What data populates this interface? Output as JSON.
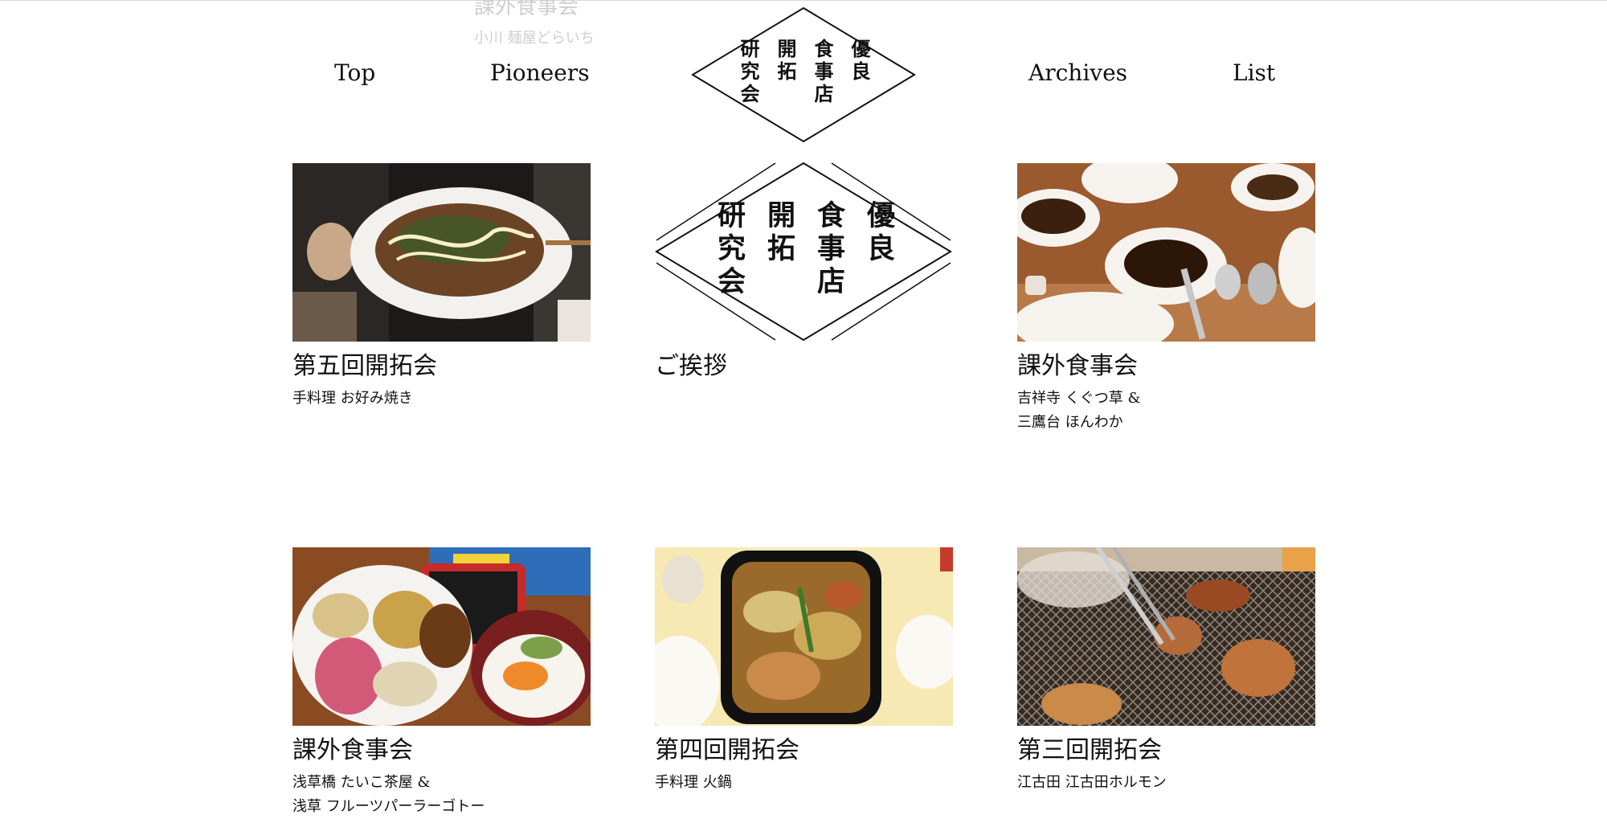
{
  "ghost_header": {
    "title": "課外食事会",
    "subtitle": "小川 麺屋どらいち"
  },
  "nav": {
    "top": "Top",
    "pioneers": "Pioneers",
    "archives": "Archives",
    "list": "List"
  },
  "logo": {
    "columns": [
      "優良",
      "食事店",
      "開拓",
      "研究会"
    ]
  },
  "cards": [
    {
      "title": "第五回開拓会",
      "lines": [
        "手料理 お好み焼き"
      ]
    },
    {
      "title": "ご挨拶",
      "lines": []
    },
    {
      "title": "課外食事会",
      "lines": [
        "吉祥寺 くぐつ草 &",
        "三鷹台 ほんわか"
      ]
    },
    {
      "title": "課外食事会",
      "lines": [
        "浅草橋 たいこ茶屋 &",
        "浅草 フルーツパーラーゴトー"
      ]
    },
    {
      "title": "第四回開拓会",
      "lines": [
        "手料理 火鍋"
      ]
    },
    {
      "title": "第三回開拓会",
      "lines": [
        "江古田 江古田ホルモン"
      ]
    }
  ]
}
